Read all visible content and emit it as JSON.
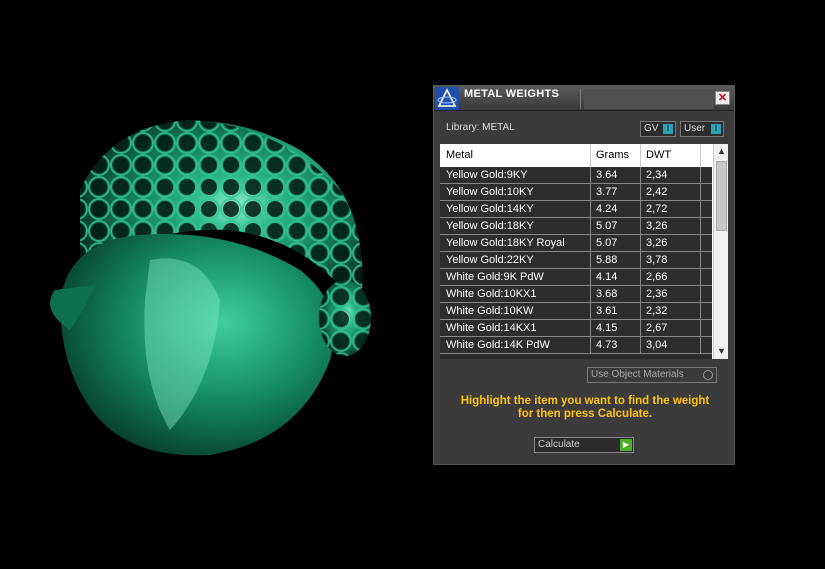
{
  "viewport": {
    "object": "3d-render",
    "color": "#1a8f6a"
  },
  "panel": {
    "title": "METAL WEIGHTS",
    "close_glyph": "✕",
    "library_label": "Library: METAL",
    "gv_label": "GV",
    "user_label": "User",
    "indicator_glyph": "I",
    "columns": [
      "Metal",
      "Grams",
      "DWT"
    ],
    "rows": [
      {
        "metal": "Yellow Gold:9KY",
        "grams": "3.64",
        "dwt": "2,34"
      },
      {
        "metal": "Yellow Gold:10KY",
        "grams": "3.77",
        "dwt": "2,42"
      },
      {
        "metal": "Yellow Gold:14KY",
        "grams": "4.24",
        "dwt": "2,72"
      },
      {
        "metal": "Yellow Gold:18KY",
        "grams": "5.07",
        "dwt": "3,26"
      },
      {
        "metal": "Yellow Gold:18KY Royal",
        "grams": "5.07",
        "dwt": "3,26"
      },
      {
        "metal": "Yellow Gold:22KY",
        "grams": "5.88",
        "dwt": "3,78"
      },
      {
        "metal": "White Gold:9K PdW",
        "grams": "4.14",
        "dwt": "2,66"
      },
      {
        "metal": "White Gold:10KX1",
        "grams": "3.68",
        "dwt": "2,36"
      },
      {
        "metal": "White Gold:10KW",
        "grams": "3.61",
        "dwt": "2,32"
      },
      {
        "metal": "White Gold:14KX1",
        "grams": "4.15",
        "dwt": "2,67"
      },
      {
        "metal": "White Gold:14K PdW",
        "grams": "4.73",
        "dwt": "3,04"
      }
    ],
    "scroll_up_glyph": "▲",
    "scroll_down_glyph": "▼",
    "use_object_materials": "Use Object Materials",
    "hint_line1": "Highlight the item you want to find the weight",
    "hint_line2": "for then press Calculate.",
    "calculate_label": "Calculate",
    "go_glyph": "▶"
  }
}
